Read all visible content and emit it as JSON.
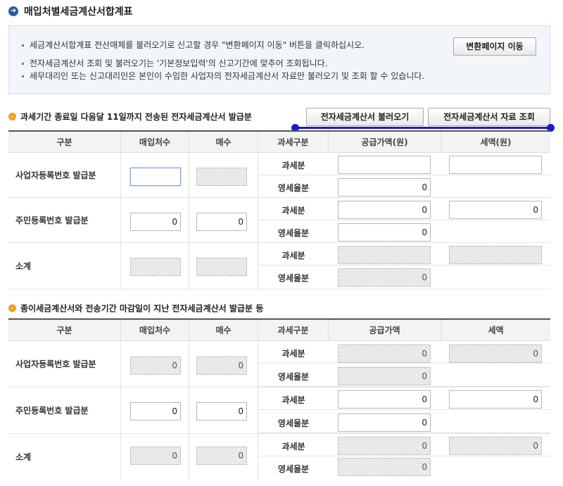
{
  "page": {
    "title": "매입처별세금계산서합계표",
    "info_lines": [
      "세금계산서합계표 전산매체를 불러오기로 신고할 경우 \"변환페이지 이동\" 버튼을 클릭하십시오.",
      "전자세금계산서 조회 및 불러오기는 '기본정보입력'의 신고기간에 맞추어 조회됩니다.",
      "세무대리인 또는 신고대리인은 본인이 수임한 사업자의 전자세금계산서 자료만 불러오기 및 조회 할 수 있습니다."
    ],
    "convert_button": "변환페이지 이동"
  },
  "section1": {
    "title": "과세기간 종료일 다음달 11일까지 전송된 전자세금계산서 발급분",
    "btn_load": "전자세금계산서 불러오기",
    "btn_query": "전자세금계산서 자료 조회",
    "headers": [
      "구분",
      "매입처수",
      "매수",
      "과세구분",
      "공급가액(원)",
      "세액(원)"
    ],
    "rows": [
      {
        "label": "사업자등록번호 발급분",
        "suppliers": "",
        "count": "",
        "taxable_label": "과세분",
        "taxable_amount": "",
        "taxable_tax": "",
        "zero_label": "영세율분",
        "zero_amount": "0"
      },
      {
        "label": "주민등록번호 발급분",
        "suppliers": "0",
        "count": "0",
        "taxable_label": "과세분",
        "taxable_amount": "0",
        "taxable_tax": "0",
        "zero_label": "영세율분",
        "zero_amount": "0"
      },
      {
        "label": "소계",
        "suppliers": "",
        "count": "",
        "taxable_label": "과세분",
        "taxable_amount": "",
        "taxable_tax": "",
        "zero_label": "영세율분",
        "zero_amount": "0"
      }
    ]
  },
  "section2": {
    "title": "종이세금계산서와 전송기간 마감일이 지난 전자세금계산서 발급분 등",
    "headers": [
      "구분",
      "매입처수",
      "매수",
      "과세구분",
      "공급가액",
      "세액"
    ],
    "rows": [
      {
        "label": "사업자등록번호 발급분",
        "suppliers": "0",
        "count": "0",
        "taxable_label": "과세분",
        "taxable_amount": "0",
        "taxable_tax": "0",
        "zero_label": "영세율분",
        "zero_amount": "0"
      },
      {
        "label": "주민등록번호 발급분",
        "suppliers": "0",
        "count": "0",
        "taxable_label": "과세분",
        "taxable_amount": "0",
        "taxable_tax": "0",
        "zero_label": "영세율분",
        "zero_amount": "0"
      },
      {
        "label": "소계",
        "suppliers": "0",
        "count": "0",
        "taxable_label": "과세분",
        "taxable_amount": "0",
        "taxable_tax": "0",
        "zero_label": "영세율분",
        "zero_amount": "0"
      }
    ]
  }
}
